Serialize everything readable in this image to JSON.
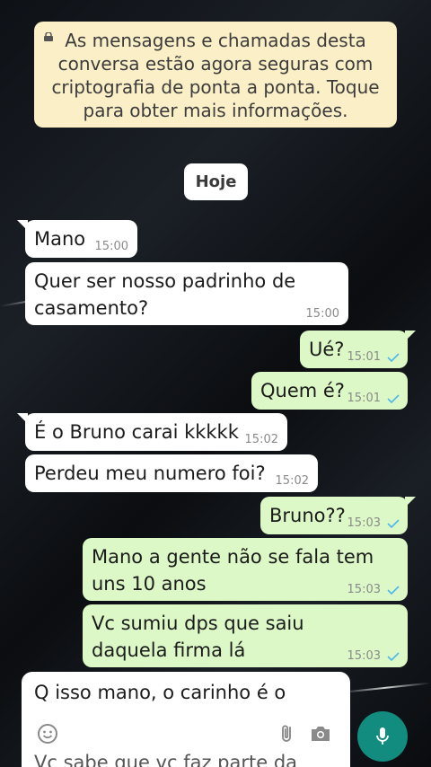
{
  "banner": {
    "icon": "lock-icon",
    "text": "As mensagens e chamadas desta conversa estão agora seguras com criptografia de ponta a ponta. Toque para obter mais informações."
  },
  "date_chip": "Hoje",
  "messages": [
    {
      "dir": "in",
      "text": "Mano",
      "time": "15:00"
    },
    {
      "dir": "in",
      "text": "Quer ser nosso padrinho de casamento?",
      "time": "15:00"
    },
    {
      "dir": "out",
      "text": "Ué?",
      "time": "15:01",
      "status": "check-icon"
    },
    {
      "dir": "out",
      "text": "Quem é?",
      "time": "15:01",
      "status": "check-icon"
    },
    {
      "dir": "in",
      "text": "É o Bruno carai kkkkk",
      "time": "15:02"
    },
    {
      "dir": "in",
      "text": "Perdeu meu numero foi?",
      "time": "15:02"
    },
    {
      "dir": "out",
      "text": "Bruno??",
      "time": "15:03",
      "status": "check-icon"
    },
    {
      "dir": "out",
      "text": "Mano a gente não se fala tem uns 10 anos",
      "time": "15:03",
      "status": "check-icon"
    },
    {
      "dir": "out",
      "text": "Vc sumiu dps que saiu daquela firma lá",
      "time": "15:03",
      "status": "check-icon"
    }
  ],
  "composer": {
    "text_line1": "Q isso mano, o carinho é o",
    "text_line2": "Vc sabe que vc faz parte da",
    "icons": [
      "emoji-icon",
      "attach-icon",
      "camera-icon",
      "mic-icon"
    ]
  },
  "colors": {
    "incoming": "#ffffff",
    "outgoing": "#dcf8c6",
    "banner": "#fbefc7",
    "accent": "#128c7e",
    "tick": "#4fb6ec"
  }
}
